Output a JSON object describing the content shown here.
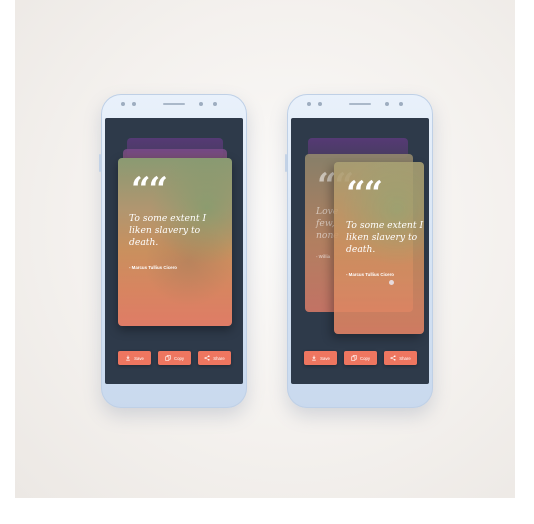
{
  "quote": {
    "text_lines": [
      "To some extent I",
      "liken slavery to",
      "death."
    ],
    "author": "- Marcus Tullius Cicero",
    "mark": "““"
  },
  "ghost_quote": {
    "text_lines": [
      "Love",
      "few,",
      "none"
    ],
    "author": "- Willia"
  },
  "actions": {
    "save_label": "Save",
    "copy_label": "Copy",
    "share_label": "Share"
  },
  "icons": {
    "save": "download-icon",
    "copy": "copy-icon",
    "share": "share-icon"
  },
  "colors": {
    "accent": "#ee7660",
    "screen_bg": "#2e3a4a",
    "phone_frame": "#d4e2f3"
  }
}
